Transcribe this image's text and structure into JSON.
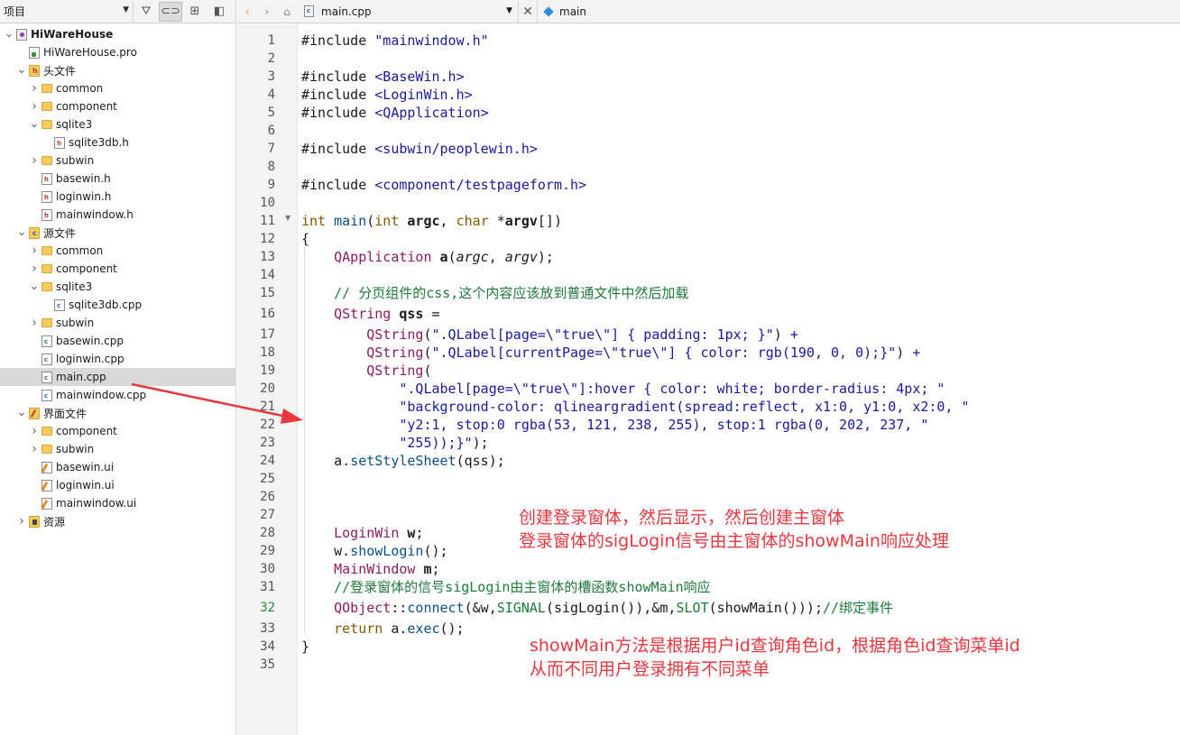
{
  "sidebar": {
    "combo_label": "项目",
    "tree": [
      {
        "label": "HiWareHouse",
        "depth": 0,
        "icon": "project-icon",
        "expand": "open",
        "bold": true
      },
      {
        "label": "HiWareHouse.pro",
        "depth": 1,
        "icon": "pro-file-icon",
        "expand": "none"
      },
      {
        "label": "头文件",
        "depth": 1,
        "icon": "header-group-icon",
        "expand": "open"
      },
      {
        "label": "common",
        "depth": 2,
        "icon": "folder-icon",
        "expand": "closed"
      },
      {
        "label": "component",
        "depth": 2,
        "icon": "folder-icon",
        "expand": "closed"
      },
      {
        "label": "sqlite3",
        "depth": 2,
        "icon": "folder-icon",
        "expand": "open"
      },
      {
        "label": "sqlite3db.h",
        "depth": 3,
        "icon": "header-file-icon",
        "expand": "none"
      },
      {
        "label": "subwin",
        "depth": 2,
        "icon": "folder-icon",
        "expand": "closed"
      },
      {
        "label": "basewin.h",
        "depth": 2,
        "icon": "header-file-icon",
        "expand": "none"
      },
      {
        "label": "loginwin.h",
        "depth": 2,
        "icon": "header-file-icon",
        "expand": "none"
      },
      {
        "label": "mainwindow.h",
        "depth": 2,
        "icon": "header-file-icon",
        "expand": "none"
      },
      {
        "label": "源文件",
        "depth": 1,
        "icon": "source-group-icon",
        "expand": "open"
      },
      {
        "label": "common",
        "depth": 2,
        "icon": "folder-icon",
        "expand": "closed"
      },
      {
        "label": "component",
        "depth": 2,
        "icon": "folder-icon",
        "expand": "closed"
      },
      {
        "label": "sqlite3",
        "depth": 2,
        "icon": "folder-icon",
        "expand": "open"
      },
      {
        "label": "sqlite3db.cpp",
        "depth": 3,
        "icon": "cpp-file-icon",
        "expand": "none"
      },
      {
        "label": "subwin",
        "depth": 2,
        "icon": "folder-icon",
        "expand": "closed"
      },
      {
        "label": "basewin.cpp",
        "depth": 2,
        "icon": "cpp-file-icon",
        "expand": "none"
      },
      {
        "label": "loginwin.cpp",
        "depth": 2,
        "icon": "cpp-file-icon",
        "expand": "none"
      },
      {
        "label": "main.cpp",
        "depth": 2,
        "icon": "cpp-file-icon",
        "expand": "none",
        "selected": true
      },
      {
        "label": "mainwindow.cpp",
        "depth": 2,
        "icon": "cpp-file-icon",
        "expand": "none"
      },
      {
        "label": "界面文件",
        "depth": 1,
        "icon": "form-group-icon",
        "expand": "open"
      },
      {
        "label": "component",
        "depth": 2,
        "icon": "folder-icon",
        "expand": "closed"
      },
      {
        "label": "subwin",
        "depth": 2,
        "icon": "folder-icon",
        "expand": "closed"
      },
      {
        "label": "basewin.ui",
        "depth": 2,
        "icon": "ui-file-icon",
        "expand": "none"
      },
      {
        "label": "loginwin.ui",
        "depth": 2,
        "icon": "ui-file-icon",
        "expand": "none"
      },
      {
        "label": "mainwindow.ui",
        "depth": 2,
        "icon": "ui-file-icon",
        "expand": "none"
      },
      {
        "label": "资源",
        "depth": 1,
        "icon": "resource-group-icon",
        "expand": "closed"
      }
    ]
  },
  "editor": {
    "file_tab": "main.cpp",
    "symbol": "main",
    "current_line": 32,
    "lines": [
      [
        [
          "#include ",
          "pp"
        ],
        [
          "\"mainwindow.h\"",
          "str"
        ]
      ],
      [],
      [
        [
          "#include ",
          "pp"
        ],
        [
          "<BaseWin.h>",
          "str"
        ]
      ],
      [
        [
          "#include ",
          "pp"
        ],
        [
          "<LoginWin.h>",
          "str"
        ]
      ],
      [
        [
          "#include ",
          "pp"
        ],
        [
          "<QApplication>",
          "str"
        ]
      ],
      [],
      [
        [
          "#include ",
          "pp"
        ],
        [
          "<subwin/peoplewin.h>",
          "str"
        ]
      ],
      [],
      [
        [
          "#include ",
          "pp"
        ],
        [
          "<component/testpageform.h>",
          "str"
        ]
      ],
      [],
      [
        [
          "int",
          "kw"
        ],
        [
          " ",
          ""
        ],
        [
          "main",
          "fn"
        ],
        [
          "(",
          ""
        ],
        [
          "int",
          "kw"
        ],
        [
          " ",
          ""
        ],
        [
          "argc",
          "b"
        ],
        [
          ", ",
          ""
        ],
        [
          "char",
          "kw"
        ],
        [
          " *",
          ""
        ],
        [
          "argv",
          "b"
        ],
        [
          "[])",
          ""
        ]
      ],
      [
        [
          "{",
          ""
        ]
      ],
      [
        [
          "    ",
          ""
        ],
        [
          "QApplication",
          "typ"
        ],
        [
          " ",
          ""
        ],
        [
          "a",
          "b"
        ],
        [
          "(",
          ""
        ],
        [
          "argc",
          "it"
        ],
        [
          ", ",
          ""
        ],
        [
          "argv",
          "it"
        ],
        [
          ");",
          ""
        ]
      ],
      [],
      [
        [
          "    ",
          ""
        ],
        [
          "// 分页组件的css,这个内容应该放到普通文件中然后加载",
          "com"
        ]
      ],
      [
        [
          "    ",
          ""
        ],
        [
          "QString",
          "typ"
        ],
        [
          " ",
          ""
        ],
        [
          "qss",
          "b"
        ],
        [
          " =",
          ""
        ]
      ],
      [
        [
          "        ",
          ""
        ],
        [
          "QString",
          "typ"
        ],
        [
          "(",
          ""
        ],
        [
          "\".QLabel[page=\\\"true\\\"] { padding: 1px; }\"",
          "str"
        ],
        [
          ") ",
          ""
        ],
        [
          "+",
          "str"
        ]
      ],
      [
        [
          "        ",
          ""
        ],
        [
          "QString",
          "typ"
        ],
        [
          "(",
          ""
        ],
        [
          "\".QLabel[currentPage=\\\"true\\\"] { color: rgb(190, 0, 0);}\"",
          "str"
        ],
        [
          ") ",
          ""
        ],
        [
          "+",
          "str"
        ]
      ],
      [
        [
          "        ",
          ""
        ],
        [
          "QString",
          "typ"
        ],
        [
          "(",
          ""
        ]
      ],
      [
        [
          "            ",
          ""
        ],
        [
          "\".QLabel[page=\\\"true\\\"]:hover { color: white; border-radius: 4px; \"",
          "str"
        ]
      ],
      [
        [
          "            ",
          ""
        ],
        [
          "\"background-color: qlineargradient(spread:reflect, x1:0, y1:0, x2:0, \"",
          "str"
        ]
      ],
      [
        [
          "            ",
          ""
        ],
        [
          "\"y2:1, stop:0 rgba(53, 121, 238, 255), stop:1 rgba(0, 202, 237, \"",
          "str"
        ]
      ],
      [
        [
          "            ",
          ""
        ],
        [
          "\"255));}\"",
          "str"
        ],
        [
          ");",
          ""
        ]
      ],
      [
        [
          "    ",
          ""
        ],
        [
          "a",
          ""
        ],
        [
          ".",
          ""
        ],
        [
          "setStyleSheet",
          "fn"
        ],
        [
          "(qss);",
          ""
        ]
      ],
      [],
      [],
      [],
      [
        [
          "    ",
          ""
        ],
        [
          "LoginWin",
          "typ"
        ],
        [
          " ",
          ""
        ],
        [
          "w",
          "b"
        ],
        [
          ";",
          ""
        ]
      ],
      [
        [
          "    ",
          ""
        ],
        [
          "w",
          ""
        ],
        [
          ".",
          ""
        ],
        [
          "showLogin",
          "fn"
        ],
        [
          "();",
          ""
        ]
      ],
      [
        [
          "    ",
          ""
        ],
        [
          "MainWindow",
          "typ"
        ],
        [
          " ",
          ""
        ],
        [
          "m",
          "b"
        ],
        [
          ";",
          ""
        ]
      ],
      [
        [
          "    ",
          ""
        ],
        [
          "//登录窗体的信号sigLogin由主窗体的槽函数showMain响应",
          "com"
        ]
      ],
      [
        [
          "    ",
          ""
        ],
        [
          "QObject",
          "typ"
        ],
        [
          "::",
          ""
        ],
        [
          "connect",
          "fn"
        ],
        [
          "(&w,",
          ""
        ],
        [
          "SIGNAL",
          "mac"
        ],
        [
          "(sigLogin()),&m,",
          ""
        ],
        [
          "SLOT",
          "mac"
        ],
        [
          "(showMain()));",
          ""
        ],
        [
          "//绑定事件",
          "com"
        ]
      ],
      [
        [
          "    ",
          ""
        ],
        [
          "return",
          "kw"
        ],
        [
          " a.",
          ""
        ],
        [
          "exec",
          "fn"
        ],
        [
          "();",
          ""
        ]
      ],
      [
        [
          "}",
          ""
        ]
      ],
      []
    ]
  },
  "annotations": {
    "note1": [
      "创建登录窗体，然后显示，然后创建主窗体",
      "登录窗体的sigLogin信号由主窗体的showMain响应处理"
    ],
    "note2": [
      "showMain方法是根据用户id查询角色id，根据角色id查询菜单id",
      "从而不同用户登录拥有不同菜单"
    ],
    "color": "#e8373f"
  }
}
